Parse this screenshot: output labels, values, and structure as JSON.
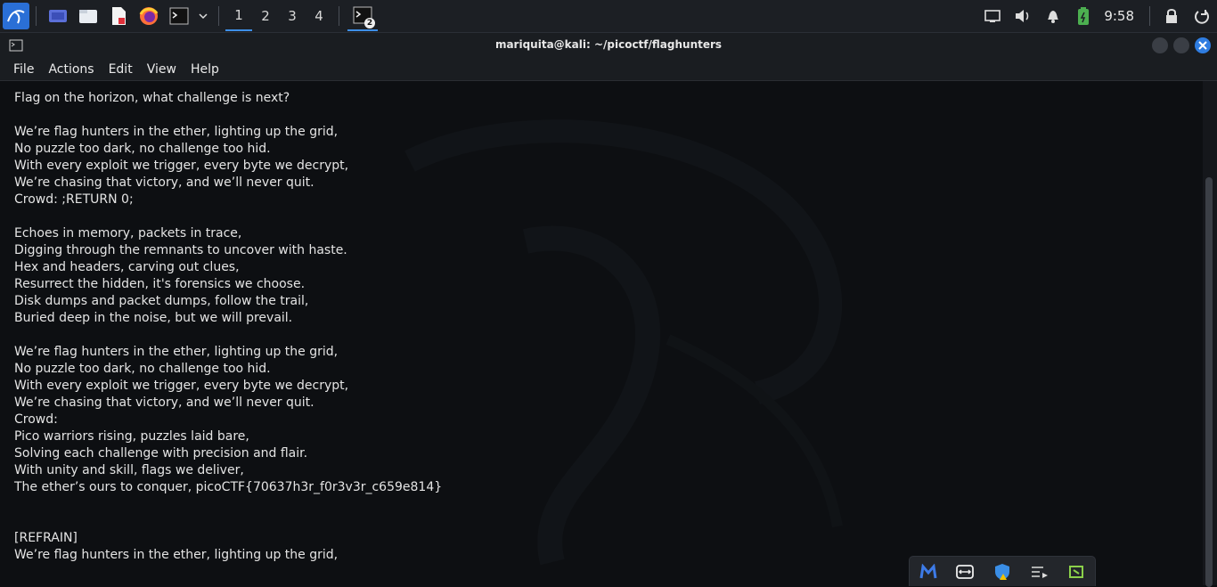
{
  "panel": {
    "workspaces": [
      "1",
      "2",
      "3",
      "4"
    ],
    "active_workspace": "1",
    "terminal_task_count": "2",
    "clock": "9:58",
    "launchers": [
      "desktop-icon",
      "file-manager-icon",
      "text-editor-icon",
      "firefox-icon",
      "terminal-icon",
      "chevron-down-icon"
    ],
    "tray_icons": [
      "display-icon",
      "volume-icon",
      "bell-icon",
      "battery-icon",
      "lock-icon",
      "power-icon"
    ]
  },
  "window": {
    "title": "mariquita@kali: ~/picoctf/flaghunters",
    "menu": [
      "File",
      "Actions",
      "Edit",
      "View",
      "Help"
    ]
  },
  "terminal": {
    "lines": [
      "Flag on the horizon, what challenge is next?",
      "",
      "We’re flag hunters in the ether, lighting up the grid,",
      "No puzzle too dark, no challenge too hid.",
      "With every exploit we trigger, every byte we decrypt,",
      "We’re chasing that victory, and we’ll never quit.",
      "Crowd: ;RETURN 0;",
      "",
      "Echoes in memory, packets in trace,",
      "Digging through the remnants to uncover with haste.",
      "Hex and headers, carving out clues,",
      "Resurrect the hidden, it's forensics we choose.",
      "Disk dumps and packet dumps, follow the trail,",
      "Buried deep in the noise, but we will prevail.",
      "",
      "We’re flag hunters in the ether, lighting up the grid,",
      "No puzzle too dark, no challenge too hid.",
      "With every exploit we trigger, every byte we decrypt,",
      "We’re chasing that victory, and we’ll never quit.",
      "Crowd:",
      "Pico warriors rising, puzzles laid bare,",
      "Solving each challenge with precision and flair.",
      "With unity and skill, flags we deliver,",
      "The ether’s ours to conquer, picoCTF{70637h3r_f0r3v3r_c659e814}",
      "",
      "",
      "[REFRAIN]",
      "We’re flag hunters in the ether, lighting up the grid,"
    ]
  },
  "dock": {
    "icons": [
      "malwarebytes-icon",
      "teamviewer-icon",
      "security-shield-icon",
      "playlist-icon",
      "app-icon"
    ]
  },
  "colors": {
    "accent": "#3d8fe8",
    "panel_bg": "#1c1f24",
    "terminal_bg": "#0d0f12",
    "close_button": "#2f7de1"
  }
}
